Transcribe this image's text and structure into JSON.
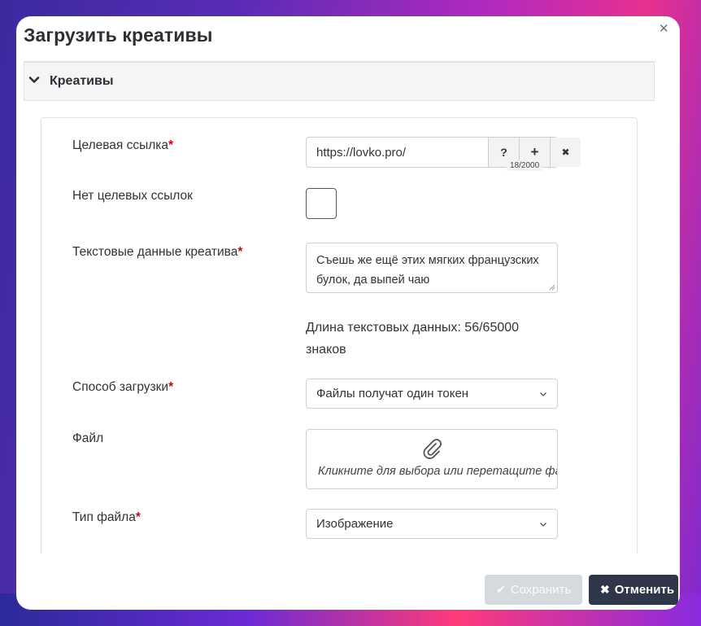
{
  "modal": {
    "title": "Загрузить креативы",
    "close_icon": "close-icon",
    "section": {
      "title": "Креативы",
      "icon": "chevron-down-icon"
    }
  },
  "form": {
    "target_link": {
      "label": "Целевая ссылка",
      "required_mark": "*",
      "value": "https://lovko.pro/",
      "help_label": "?",
      "add_label": "+",
      "clear_label": "✖",
      "counter": "18/2000"
    },
    "no_target_links": {
      "label": "Нет целевых ссылок",
      "checked": false
    },
    "creative_text": {
      "label": "Текстовые данные креатива",
      "required_mark": "*",
      "value": "Съешь же ещё этих мягких французских булок, да выпей чаю",
      "length_info": "Длина текстовых данных: 56/65000 знаков"
    },
    "upload_method": {
      "label": "Способ загрузки",
      "required_mark": "*",
      "selected": "Файлы получат один токен"
    },
    "file": {
      "label": "Файл",
      "icon": "paperclip-icon",
      "dropzone_text": "Кликните для выбора или перетащите файл"
    },
    "file_type": {
      "label": "Тип файла",
      "required_mark": "*",
      "selected": "Изображение"
    }
  },
  "footer": {
    "save_label": "Сохранить",
    "save_icon": "check-icon",
    "cancel_label": "Отменить",
    "cancel_icon": "times-icon"
  },
  "colors": {
    "primary_dark": "#2d3748",
    "disabled": "#d6d9dd",
    "required": "#d0021b"
  }
}
